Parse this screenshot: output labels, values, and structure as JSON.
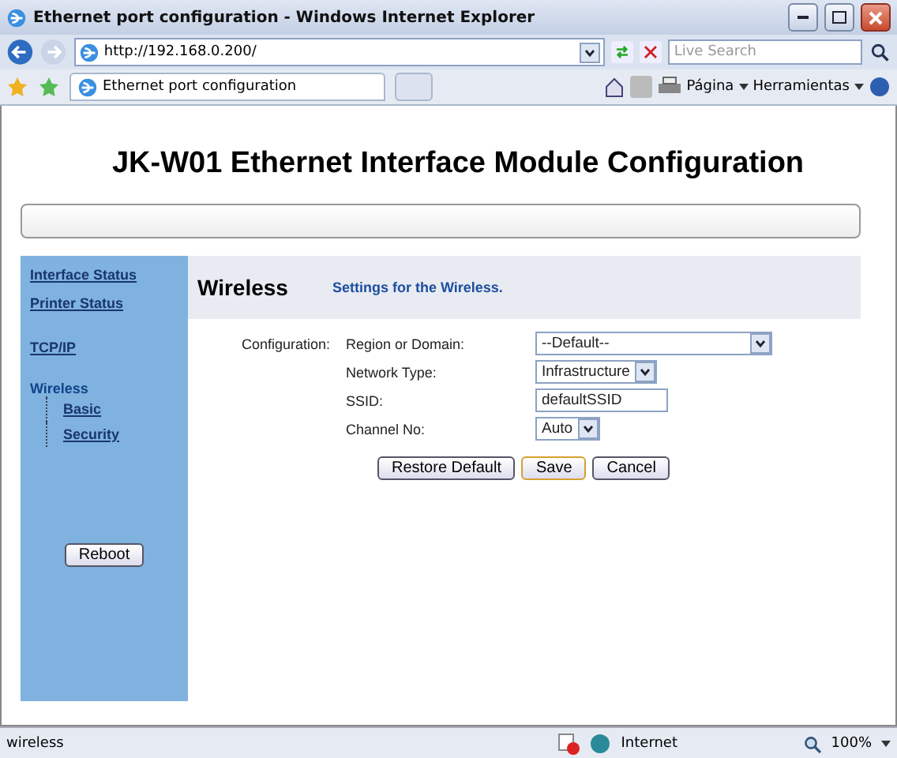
{
  "window": {
    "title": "Ethernet port configuration - Windows Internet Explorer"
  },
  "address_bar": {
    "url": "http://192.168.0.200/"
  },
  "search": {
    "placeholder": "Live Search"
  },
  "tabs": [
    {
      "label": "Ethernet port configuration",
      "selected": true
    }
  ],
  "command_bar": [
    "Página",
    "Herramientas"
  ],
  "page": {
    "heading": "JK-W01 Ethernet Interface Module Configuration",
    "nav": [
      {
        "label": "Interface Status",
        "selected": false
      },
      {
        "label": "Printer Status",
        "selected": false
      },
      {
        "label": "TCP/IP",
        "selected": false
      },
      {
        "label": "Wireless",
        "selected": true,
        "children": [
          {
            "label": "Basic",
            "selected": false
          },
          {
            "label": "Security",
            "selected": false
          }
        ]
      }
    ],
    "reboot_button": "Reboot",
    "section_title": "Wireless",
    "section_subtitle": "Settings for the Wireless.",
    "group_label": "Configuration:",
    "fields": [
      {
        "label": "Region or Domain:",
        "kind": "select",
        "value": "--Default--"
      },
      {
        "label": "Network Type:",
        "kind": "select",
        "value": "Infrastructure"
      },
      {
        "label": "SSID:",
        "kind": "text",
        "value": "defaultSSID"
      },
      {
        "label": "Channel No:",
        "kind": "select",
        "value": "Auto"
      }
    ],
    "buttons": [
      {
        "label": "Restore Default",
        "kind": "normal"
      },
      {
        "label": "Save",
        "kind": "default"
      },
      {
        "label": "Cancel",
        "kind": "normal"
      }
    ]
  },
  "status_bar": {
    "text": "wireless",
    "zone": "Internet",
    "zoom": "100%"
  }
}
